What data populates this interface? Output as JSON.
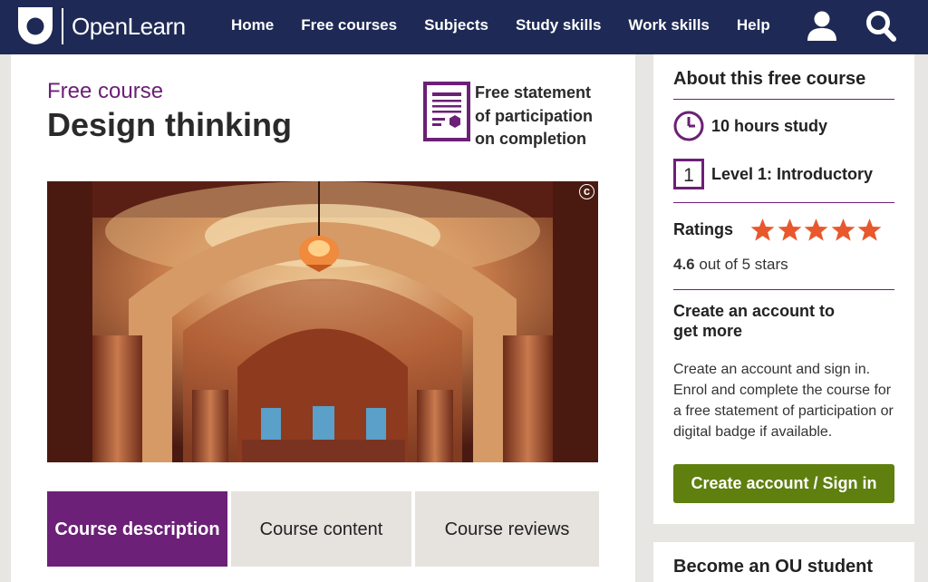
{
  "brand": {
    "name": "OpenLearn"
  },
  "nav": {
    "items": [
      "Home",
      "Free courses",
      "Subjects",
      "Study skills",
      "Work skills",
      "Help"
    ]
  },
  "course": {
    "kicker": "Free course",
    "title": "Design thinking",
    "statement": "Free statement of participation on completion"
  },
  "tabs": [
    "Course description",
    "Course content",
    "Course reviews"
  ],
  "about": {
    "heading": "About this free course",
    "hours": "10 hours study",
    "level_number": "1",
    "level": "Level 1: Introductory",
    "ratings_label": "Ratings",
    "rating_value": "4.6",
    "rating_suffix": " out of 5 stars",
    "stars": 5
  },
  "account": {
    "heading": "Create an account to get more",
    "body": "Create an account and sign in. Enrol and complete the course for a free statement of participation or digital badge if available.",
    "button": "Create account / Sign in"
  },
  "student": {
    "heading": "Become an OU student"
  },
  "colors": {
    "navy": "#1e2a55",
    "purple": "#6c2077",
    "green": "#5f7f0f",
    "star": "#e8582c"
  }
}
